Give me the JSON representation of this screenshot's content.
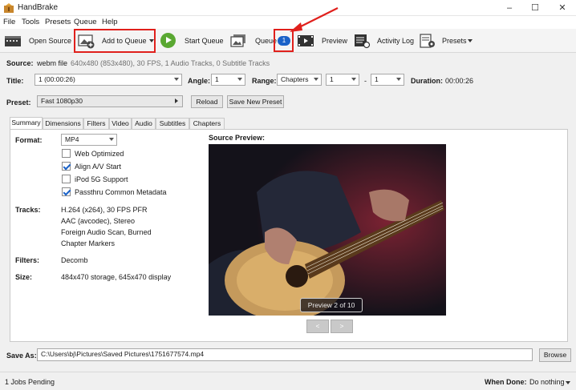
{
  "window": {
    "title": "HandBrake"
  },
  "menu": [
    "File",
    "Tools",
    "Presets",
    "Queue",
    "Help"
  ],
  "toolbar": {
    "open_source": "Open Source",
    "add_to_queue": "Add to Queue",
    "start_queue": "Start Queue",
    "queue": "Queue",
    "queue_badge": "1",
    "preview": "Preview",
    "activity_log": "Activity Log",
    "presets": "Presets"
  },
  "source": {
    "label": "Source:",
    "value": "webm file",
    "info": "640x480 (853x480), 30 FPS, 1 Audio Tracks, 0 Subtitle Tracks"
  },
  "title_row": {
    "title_label": "Title:",
    "title_value": "1 (00:00:26)",
    "angle_label": "Angle:",
    "angle_value": "1",
    "range_label": "Range:",
    "range_value": "Chapters",
    "range_start": "1",
    "range_sep": "-",
    "range_end": "1",
    "duration_label": "Duration:",
    "duration_value": "00:00:26"
  },
  "preset": {
    "label": "Preset:",
    "value": "Fast 1080p30",
    "reload": "Reload",
    "save_new": "Save New Preset"
  },
  "tabs": [
    "Summary",
    "Dimensions",
    "Filters",
    "Video",
    "Audio",
    "Subtitles",
    "Chapters"
  ],
  "summary": {
    "format_label": "Format:",
    "format_value": "MP4",
    "options": [
      {
        "label": "Web Optimized",
        "checked": false
      },
      {
        "label": "Align A/V Start",
        "checked": true
      },
      {
        "label": "iPod 5G Support",
        "checked": false
      },
      {
        "label": "Passthru Common Metadata",
        "checked": true
      }
    ],
    "tracks_label": "Tracks:",
    "tracks": [
      "H.264 (x264), 30 FPS PFR",
      "AAC (avcodec), Stereo",
      "Foreign Audio Scan, Burned",
      "Chapter Markers"
    ],
    "filters_label": "Filters:",
    "filters_value": "Decomb",
    "size_label": "Size:",
    "size_value": "484x470 storage, 645x470 display",
    "source_preview_label": "Source Preview:",
    "preview_counter": "Preview 2 of 10",
    "prev": "<",
    "next": ">"
  },
  "save": {
    "label": "Save As:",
    "path": "C:\\Users\\bj\\Pictures\\Saved Pictures\\1751677574.mp4",
    "browse": "Browse"
  },
  "status": {
    "jobs": "1 Jobs Pending",
    "when_done_label": "When Done:",
    "when_done_value": "Do nothing"
  },
  "colors": {
    "highlight": "#e0201c",
    "badge": "#1a62c8",
    "play": "#5aa832"
  }
}
